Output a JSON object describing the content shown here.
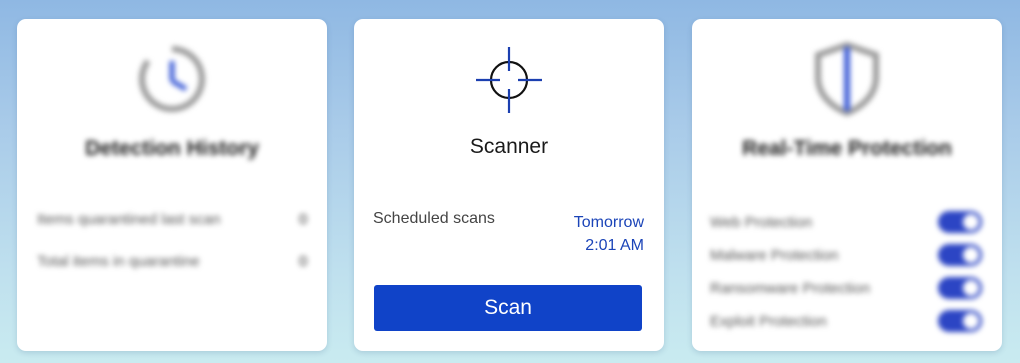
{
  "detection_history": {
    "title": "Detection History",
    "rows": [
      {
        "label": "Items quarantined last scan",
        "value": "0"
      },
      {
        "label": "Total items in quarantine",
        "value": "0"
      }
    ]
  },
  "scanner": {
    "title": "Scanner",
    "scheduled_label": "Scheduled scans",
    "scheduled_day": "Tomorrow",
    "scheduled_time": "2:01 AM",
    "scan_button": "Scan"
  },
  "realtime_protection": {
    "title": "Real-Time Protection",
    "items": [
      {
        "label": "Web Protection",
        "enabled": true
      },
      {
        "label": "Malware Protection",
        "enabled": true
      },
      {
        "label": "Ransomware Protection",
        "enabled": true
      },
      {
        "label": "Exploit Protection",
        "enabled": true
      }
    ]
  },
  "colors": {
    "accent": "#1043c8",
    "link": "#1b44b8",
    "toggle_on": "#2c45c4"
  }
}
